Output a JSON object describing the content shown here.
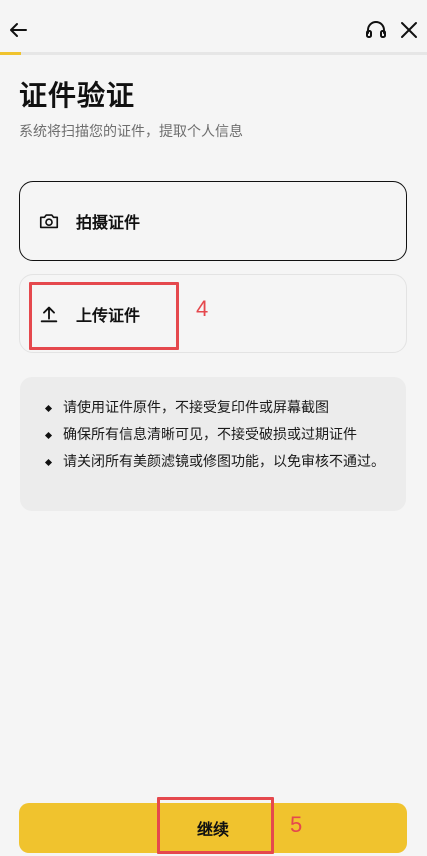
{
  "header": {
    "back_icon": "arrow-left-icon",
    "support_icon": "headset-icon",
    "close_icon": "close-icon",
    "progress_fraction": 0.05,
    "accent_color": "#f0c32e"
  },
  "page": {
    "title": "证件验证",
    "subtitle": "系统将扫描您的证件，提取个人信息"
  },
  "options": [
    {
      "icon": "camera-icon",
      "label": "拍摄证件",
      "selected": true
    },
    {
      "icon": "upload-icon",
      "label": "上传证件",
      "selected": false
    }
  ],
  "tips": [
    "请使用证件原件，不接受复印件或屏幕截图",
    "确保所有信息清晰可见，不接受破损或过期证件",
    "请关闭所有美颜滤镜或修图功能，以免审核不通过。"
  ],
  "footer": {
    "continue_label": "继续"
  },
  "annotations": [
    {
      "number": "4",
      "color": "#e5484d"
    },
    {
      "number": "5",
      "color": "#e5484d"
    }
  ]
}
